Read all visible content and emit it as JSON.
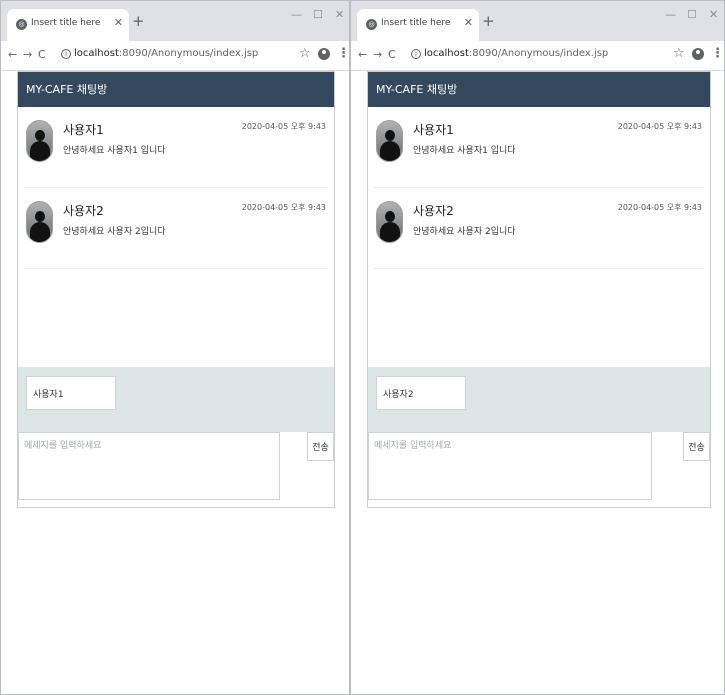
{
  "browser": {
    "tab_title": "Insert title here",
    "url_host": "localhost",
    "url_path": ":8090/Anonymous/index.jsp"
  },
  "left": {
    "chat_title": "MY-CAFE 채팅방",
    "messages": [
      {
        "user": "사용자1",
        "time": "2020-04-05 오후 9:43",
        "text": "안녕하세요 사용자1 입니다"
      },
      {
        "user": "사용자2",
        "time": "2020-04-05 오후 9:43",
        "text": "안녕하세요 사용자 2입니다"
      }
    ],
    "name_value": "사용자1",
    "message_placeholder": "메세지를 입력하세요",
    "send_label": "전송"
  },
  "right": {
    "chat_title": "MY-CAFE 채팅방",
    "messages": [
      {
        "user": "사용자1",
        "time": "2020-04-05 오후 9:43",
        "text": "안녕하세요 사용자1 입니다"
      },
      {
        "user": "사용자2",
        "time": "2020-04-05 오후 9:43",
        "text": "안녕하세요 사용자 2입니다"
      }
    ],
    "name_value": "사용자2",
    "message_placeholder": "메세지를 입력하세요",
    "send_label": "전송"
  },
  "colors": {
    "header": "#34495e",
    "name_area": "#dee5e7",
    "tabstrip": "#dee1e6"
  },
  "icons": [
    "globe-icon",
    "close-icon",
    "plus-icon",
    "back-icon",
    "forward-icon",
    "reload-icon",
    "info-icon",
    "star-icon",
    "profile-icon",
    "menu-icon",
    "avatar-icon"
  ]
}
